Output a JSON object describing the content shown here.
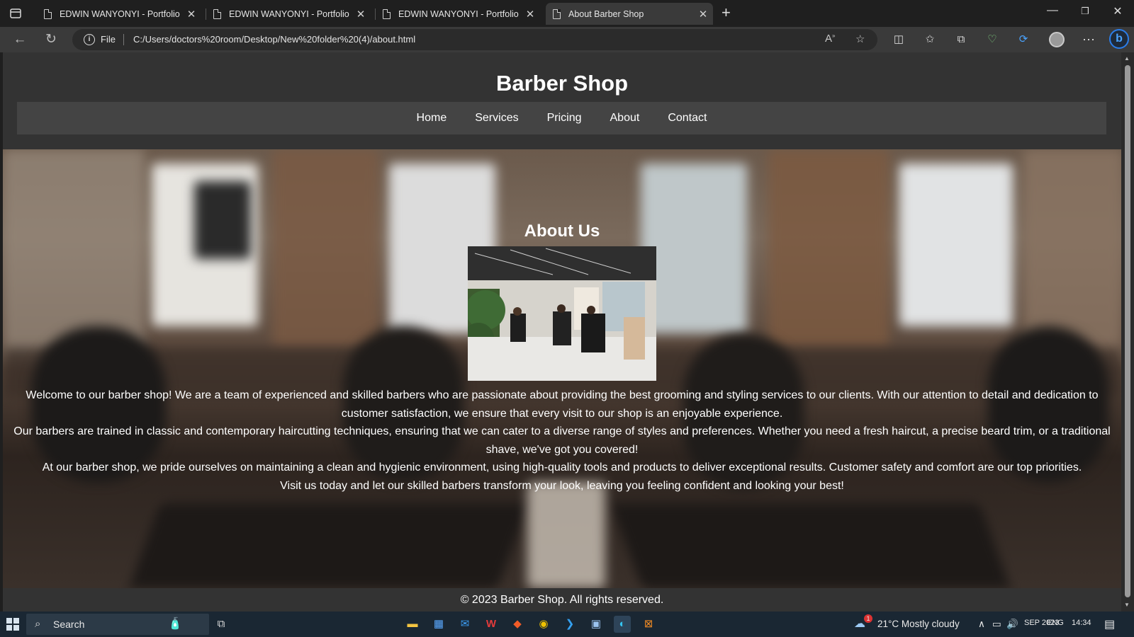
{
  "browser": {
    "tabs": [
      {
        "label": "EDWIN WANYONYI - Portfolio",
        "active": false
      },
      {
        "label": "EDWIN WANYONYI - Portfolio",
        "active": false
      },
      {
        "label": "EDWIN WANYONYI - Portfolio",
        "active": false
      },
      {
        "label": "About Barber Shop",
        "active": true
      }
    ],
    "address": {
      "scheme_label": "File",
      "url": "C:/Users/doctors%20room/Desktop/New%20folder%20(4)/about.html"
    }
  },
  "site": {
    "title": "Barber Shop",
    "nav": [
      "Home",
      "Services",
      "Pricing",
      "About",
      "Contact"
    ],
    "about": {
      "heading": "About Us",
      "paragraphs": [
        "Welcome to our barber shop! We are a team of experienced and skilled barbers who are passionate about providing the best grooming and styling services to our clients. With our attention to detail and dedication to customer satisfaction, we ensure that every visit to our shop is an enjoyable experience.",
        "Our barbers are trained in classic and contemporary haircutting techniques, ensuring that we can cater to a diverse range of styles and preferences. Whether you need a fresh haircut, a precise beard trim, or a traditional shave, we've got you covered!",
        "At our barber shop, we pride ourselves on maintaining a clean and hygienic environment, using high-quality tools and products to deliver exceptional results. Customer safety and comfort are our top priorities.",
        "Visit us today and let our skilled barbers transform your look, leaving you feeling confident and looking your best!"
      ]
    },
    "footer": "© 2023 Barber Shop. All rights reserved."
  },
  "taskbar": {
    "search_label": "Search",
    "weather": "21°C  Mostly cloudy",
    "clock": "14:34",
    "date": "SEP 2023",
    "lang": "ENG",
    "notification_badge": "1",
    "colors": {
      "taskbar_bg": "#1a2733",
      "accent": "#2b7de9"
    }
  }
}
